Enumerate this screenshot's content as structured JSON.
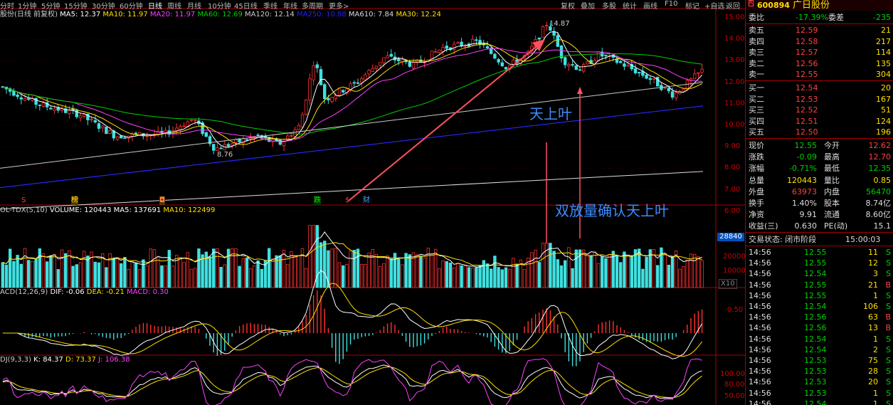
{
  "menu": {
    "left_items": [
      "分时",
      "1分钟",
      "5分钟",
      "15分钟",
      "30分钟",
      "60分钟",
      "日线",
      "周线",
      "月线",
      "10分钟",
      "45日线",
      "季线",
      "年线",
      "多周期",
      "更多>"
    ],
    "active": "日线",
    "right_items": [
      "复权",
      "叠加",
      "多股",
      "统计",
      "画线",
      "F10",
      "标记",
      "+自选",
      "返回"
    ]
  },
  "main_legend": {
    "title": "股份(日线 前复权)",
    "ma": [
      {
        "label": "MA5: 12.37",
        "color": "#ffffff"
      },
      {
        "label": "MA10: 11.97",
        "color": "#ffe000"
      },
      {
        "label": "MA20: 11.97",
        "color": "#ff40ff"
      },
      {
        "label": "MA60: 12.69",
        "color": "#00d000"
      },
      {
        "label": "MA120: 12.14",
        "color": "#cccccc"
      },
      {
        "label": "MA250: 10.88",
        "color": "#2020ff"
      },
      {
        "label": "MA610: 7.84",
        "color": "#dddddd"
      },
      {
        "label": "MA30: 12.24",
        "color": "#ffe000"
      }
    ]
  },
  "price_axis": [
    "15.00",
    "14.00",
    "13.00",
    "12.00",
    "11.00",
    "10.00",
    "9.00",
    "8.00",
    "7.00",
    "6.00"
  ],
  "annotations": {
    "high": "14.87",
    "low": "8.76",
    "tianshangye": "天上叶",
    "confirm": "双放量确认天上叶"
  },
  "event_markers": [
    "S",
    "榜",
    "◘",
    "跌",
    "$",
    "财"
  ],
  "volume_legend": {
    "title": "OL-TDX(5,10)",
    "items": [
      {
        "label": "VOLUME: 120443",
        "color": "#ffffff"
      },
      {
        "label": "MA5: 137691",
        "color": "#ffffff"
      },
      {
        "label": "MA10: 122499",
        "color": "#ffe000"
      }
    ]
  },
  "volume_axis": [
    "28840",
    "20000",
    "10000",
    "X10"
  ],
  "macd_legend": {
    "title": "ACD(12,26,9)",
    "items": [
      {
        "label": "DIF: -0.06",
        "color": "#ffffff"
      },
      {
        "label": "DEA: -0.21",
        "color": "#ffe000"
      },
      {
        "label": "MACD: 0.30",
        "color": "#ff40ff"
      }
    ]
  },
  "macd_axis": [
    "0.50"
  ],
  "kdj_legend": {
    "title": "DJ(9,3,3)",
    "items": [
      {
        "label": "K: 84.37",
        "color": "#ffffff"
      },
      {
        "label": "D: 73.37",
        "color": "#ffe000"
      },
      {
        "label": "J: 106.38",
        "color": "#ff40ff"
      }
    ]
  },
  "kdj_axis": [
    "100.00",
    "80.00",
    "50.00"
  ],
  "stock": {
    "code": "600894",
    "name": "广日股份"
  },
  "order_book": {
    "wei_bi": {
      "label": "委比",
      "value": "-17.39%",
      "label2": "委差",
      "value2": "-235"
    },
    "sell": [
      {
        "label": "卖五",
        "price": "12.59",
        "vol": "21"
      },
      {
        "label": "卖四",
        "price": "12.58",
        "vol": "217"
      },
      {
        "label": "卖三",
        "price": "12.57",
        "vol": "114"
      },
      {
        "label": "卖二",
        "price": "12.56",
        "vol": "135"
      },
      {
        "label": "卖一",
        "price": "12.55",
        "vol": "304"
      }
    ],
    "buy": [
      {
        "label": "买一",
        "price": "12.54",
        "vol": "20"
      },
      {
        "label": "买二",
        "price": "12.53",
        "vol": "167"
      },
      {
        "label": "买三",
        "price": "12.52",
        "vol": "51"
      },
      {
        "label": "买四",
        "price": "12.51",
        "vol": "124"
      },
      {
        "label": "买五",
        "price": "12.50",
        "vol": "196"
      }
    ]
  },
  "quote": [
    {
      "l1": "现价",
      "v1": "12.55",
      "c1": "green",
      "l2": "今开",
      "v2": "12.62",
      "c2": "red"
    },
    {
      "l1": "涨跌",
      "v1": "-0.09",
      "c1": "green",
      "l2": "最高",
      "v2": "12.70",
      "c2": "red"
    },
    {
      "l1": "涨幅",
      "v1": "-0.71%",
      "c1": "green",
      "l2": "最低",
      "v2": "12.35",
      "c2": "green"
    },
    {
      "l1": "总量",
      "v1": "120443",
      "c1": "yellow",
      "l2": "量比",
      "v2": "0.85",
      "c2": "yellow"
    },
    {
      "l1": "外盘",
      "v1": "63973",
      "c1": "red",
      "l2": "内盘",
      "v2": "56470",
      "c2": "green"
    },
    {
      "l1": "换手",
      "v1": "1.40%",
      "c1": "white",
      "l2": "股本",
      "v2": "8.74亿",
      "c2": "white"
    },
    {
      "l1": "净资",
      "v1": "9.91",
      "c1": "white",
      "l2": "流通",
      "v2": "8.60亿",
      "c2": "white"
    },
    {
      "l1": "收益(三)",
      "v1": "0.630",
      "c1": "white",
      "l2": "PE(动)",
      "v2": "15.1",
      "c2": "white"
    }
  ],
  "trade_status": {
    "label": "交易状态: 闭市阶段",
    "time": "15:00:03"
  },
  "ticks": [
    {
      "time": "14:56",
      "price": "12.55",
      "vol": "11",
      "side": "S"
    },
    {
      "time": "14:56",
      "price": "12.55",
      "vol": "12",
      "side": "S"
    },
    {
      "time": "14:56",
      "price": "12.54",
      "vol": "3",
      "side": "S"
    },
    {
      "time": "14:56",
      "price": "12.55",
      "vol": "21",
      "side": "B"
    },
    {
      "time": "14:56",
      "price": "12.55",
      "vol": "1",
      "side": "S"
    },
    {
      "time": "14:56",
      "price": "12.54",
      "vol": "106",
      "side": "S"
    },
    {
      "time": "14:56",
      "price": "12.56",
      "vol": "63",
      "side": "B"
    },
    {
      "time": "14:56",
      "price": "12.56",
      "vol": "13",
      "side": "B"
    },
    {
      "time": "14:56",
      "price": "12.54",
      "vol": "1",
      "side": "S"
    },
    {
      "time": "14:56",
      "price": "12.54",
      "vol": "2",
      "side": "S"
    },
    {
      "time": "14:56",
      "price": "12.53",
      "vol": "75",
      "side": "S"
    },
    {
      "time": "14:56",
      "price": "12.53",
      "vol": "28",
      "side": "S"
    },
    {
      "time": "14:56",
      "price": "12.53",
      "vol": "20",
      "side": "S"
    },
    {
      "time": "14:56",
      "price": "12.53",
      "vol": "1",
      "side": "S"
    },
    {
      "time": "14:56",
      "price": "12.54",
      "vol": "1",
      "side": "S"
    }
  ]
}
